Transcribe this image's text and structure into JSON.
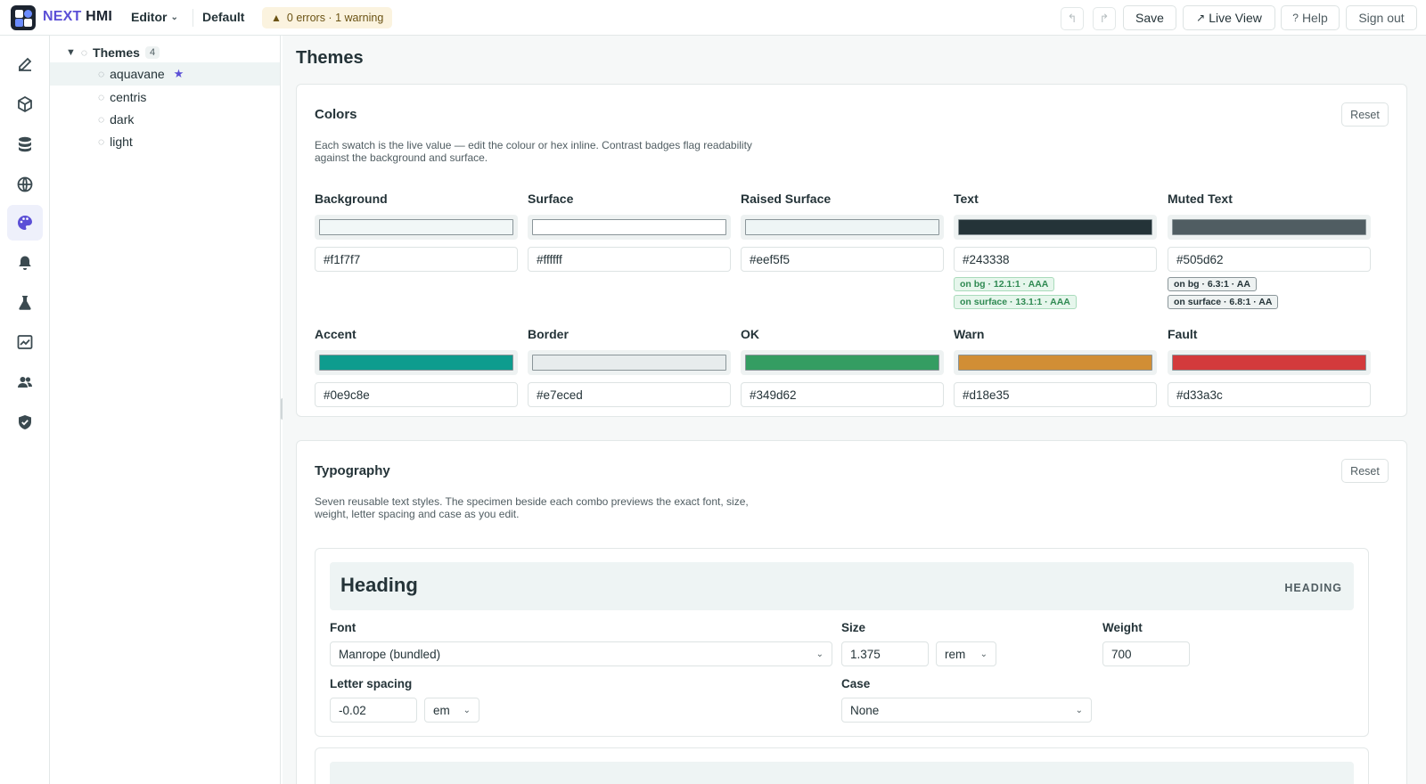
{
  "app": {
    "brand_next": "NEXT",
    "brand_hmi": "HMI",
    "editor_menu": "Editor",
    "project": "Default",
    "status": "0 errors · 1 warning"
  },
  "toolbar": {
    "save": "Save",
    "live_view": "Live View",
    "help": "Help",
    "sign_out": "Sign out"
  },
  "rail": {
    "items": [
      {
        "icon": "edit-icon"
      },
      {
        "icon": "cube-icon"
      },
      {
        "icon": "database-icon"
      },
      {
        "icon": "globe-icon"
      },
      {
        "icon": "palette-icon",
        "active": true
      },
      {
        "icon": "bell-icon"
      },
      {
        "icon": "flask-icon"
      },
      {
        "icon": "chart-icon"
      },
      {
        "icon": "users-icon"
      },
      {
        "icon": "shield-icon"
      }
    ]
  },
  "tree": {
    "root_label": "Themes",
    "root_count": "4",
    "items": [
      {
        "label": "aquavane",
        "default": true
      },
      {
        "label": "centris"
      },
      {
        "label": "dark"
      },
      {
        "label": "light"
      }
    ]
  },
  "page": {
    "title": "Themes"
  },
  "colors": {
    "title": "Colors",
    "reset": "Reset",
    "description": "Each swatch is the live value — edit the colour or hex inline. Contrast badges flag readability against the background and surface.",
    "swatches": [
      {
        "label": "Background",
        "hex": "#f1f7f7"
      },
      {
        "label": "Surface",
        "hex": "#ffffff"
      },
      {
        "label": "Raised Surface",
        "hex": "#eef5f5"
      },
      {
        "label": "Text",
        "hex": "#243338",
        "badges": [
          "on bg · 12.1:1 · AAA",
          "on surface · 13.1:1 · AAA"
        ]
      },
      {
        "label": "Muted Text",
        "hex": "#505d62",
        "badges": [
          "on bg · 6.3:1 · AA",
          "on surface · 6.8:1 · AA"
        ]
      },
      {
        "label": "Accent",
        "hex": "#0e9c8e"
      },
      {
        "label": "Border",
        "hex": "#e7eced"
      },
      {
        "label": "OK",
        "hex": "#349d62"
      },
      {
        "label": "Warn",
        "hex": "#d18e35"
      },
      {
        "label": "Fault",
        "hex": "#d33a3c"
      }
    ]
  },
  "typography": {
    "title": "Typography",
    "reset": "Reset",
    "description": "Seven reusable text styles. The specimen beside each combo previews the exact font, size, weight, letter spacing and case as you edit.",
    "style": {
      "specimen": "Heading",
      "tag": "HEADING",
      "font_label": "Font",
      "font_value": "Manrope (bundled)",
      "size_label": "Size",
      "size_value": "1.375",
      "size_unit": "rem",
      "weight_label": "Weight",
      "weight_value": "700",
      "letter_spacing_label": "Letter spacing",
      "letter_spacing_value": "-0.02",
      "letter_spacing_unit": "em",
      "case_label": "Case",
      "case_value": "None"
    }
  }
}
